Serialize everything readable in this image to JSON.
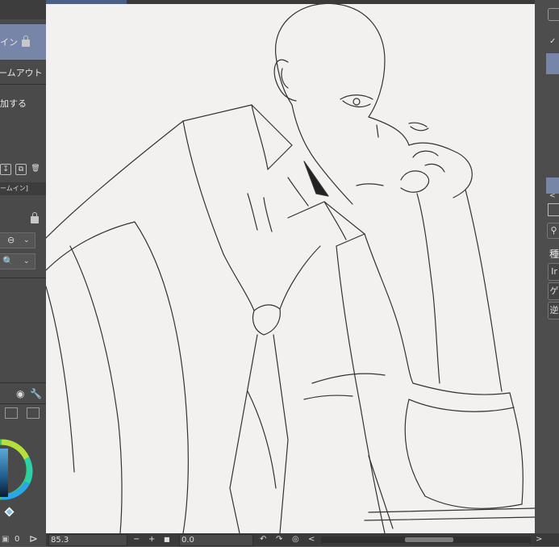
{
  "left_panel": {
    "items": [
      {
        "label": "イン"
      },
      {
        "label": "ームアウト"
      },
      {
        "label": "加する"
      }
    ],
    "tab_label": "ームイン]",
    "layer_icons": [
      "duplicate-icon",
      "copy-icon",
      "trash-icon"
    ],
    "navigator_icons": [
      "dial-icon",
      "wrench-icon"
    ]
  },
  "right_panel": {
    "chars": [
      "種",
      "Ir",
      "ゲ",
      "逆"
    ]
  },
  "status_bar": {
    "zoom": "85.3",
    "minus": "−",
    "plus": "+",
    "rotation": "0.0",
    "brush_size": "0"
  }
}
